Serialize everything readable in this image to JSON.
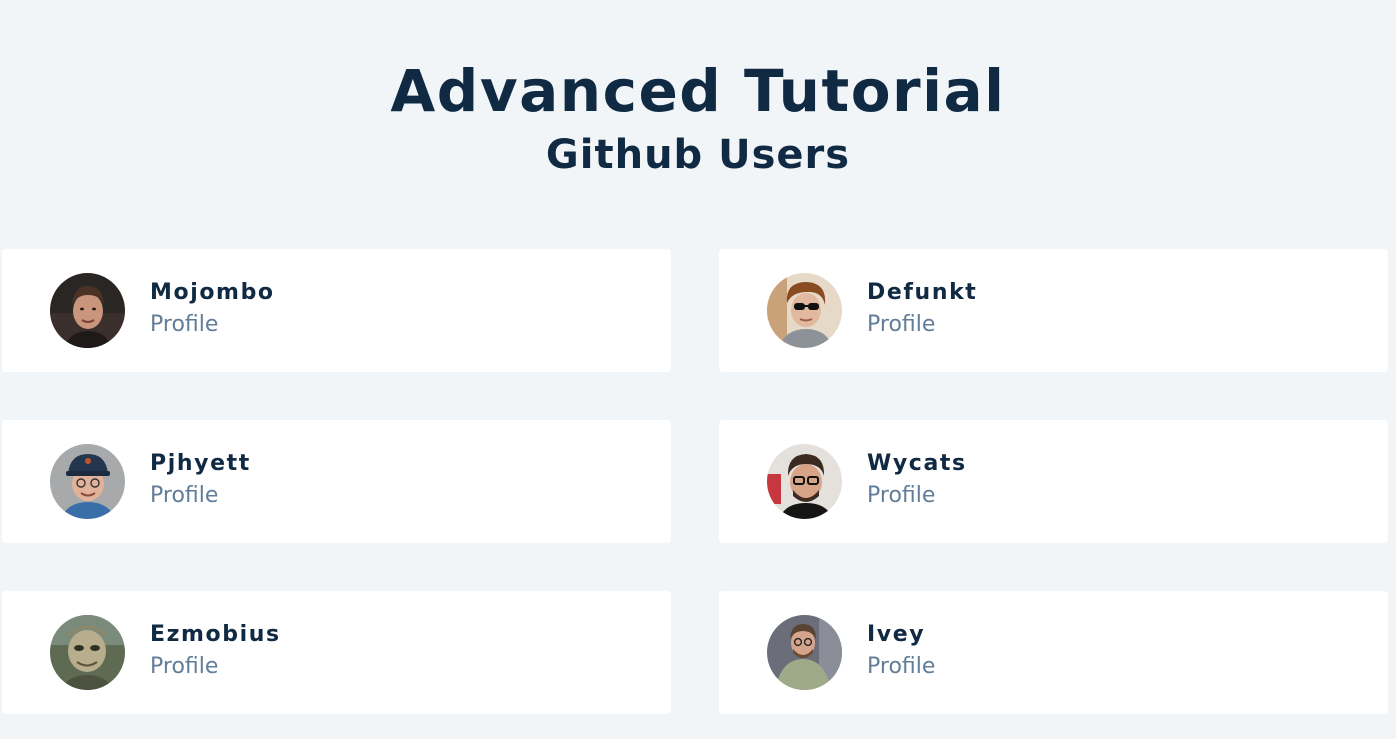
{
  "header": {
    "title": "Advanced Tutorial",
    "subtitle": "Github Users"
  },
  "users": [
    {
      "name": "Mojombo",
      "link_label": "Profile"
    },
    {
      "name": "Defunkt",
      "link_label": "Profile"
    },
    {
      "name": "Pjhyett",
      "link_label": "Profile"
    },
    {
      "name": "Wycats",
      "link_label": "Profile"
    },
    {
      "name": "Ezmobius",
      "link_label": "Profile"
    },
    {
      "name": "Ivey",
      "link_label": "Profile"
    }
  ],
  "colors": {
    "background": "#f1f5f8",
    "card": "#ffffff",
    "heading": "#102a43",
    "link": "#627d98"
  }
}
